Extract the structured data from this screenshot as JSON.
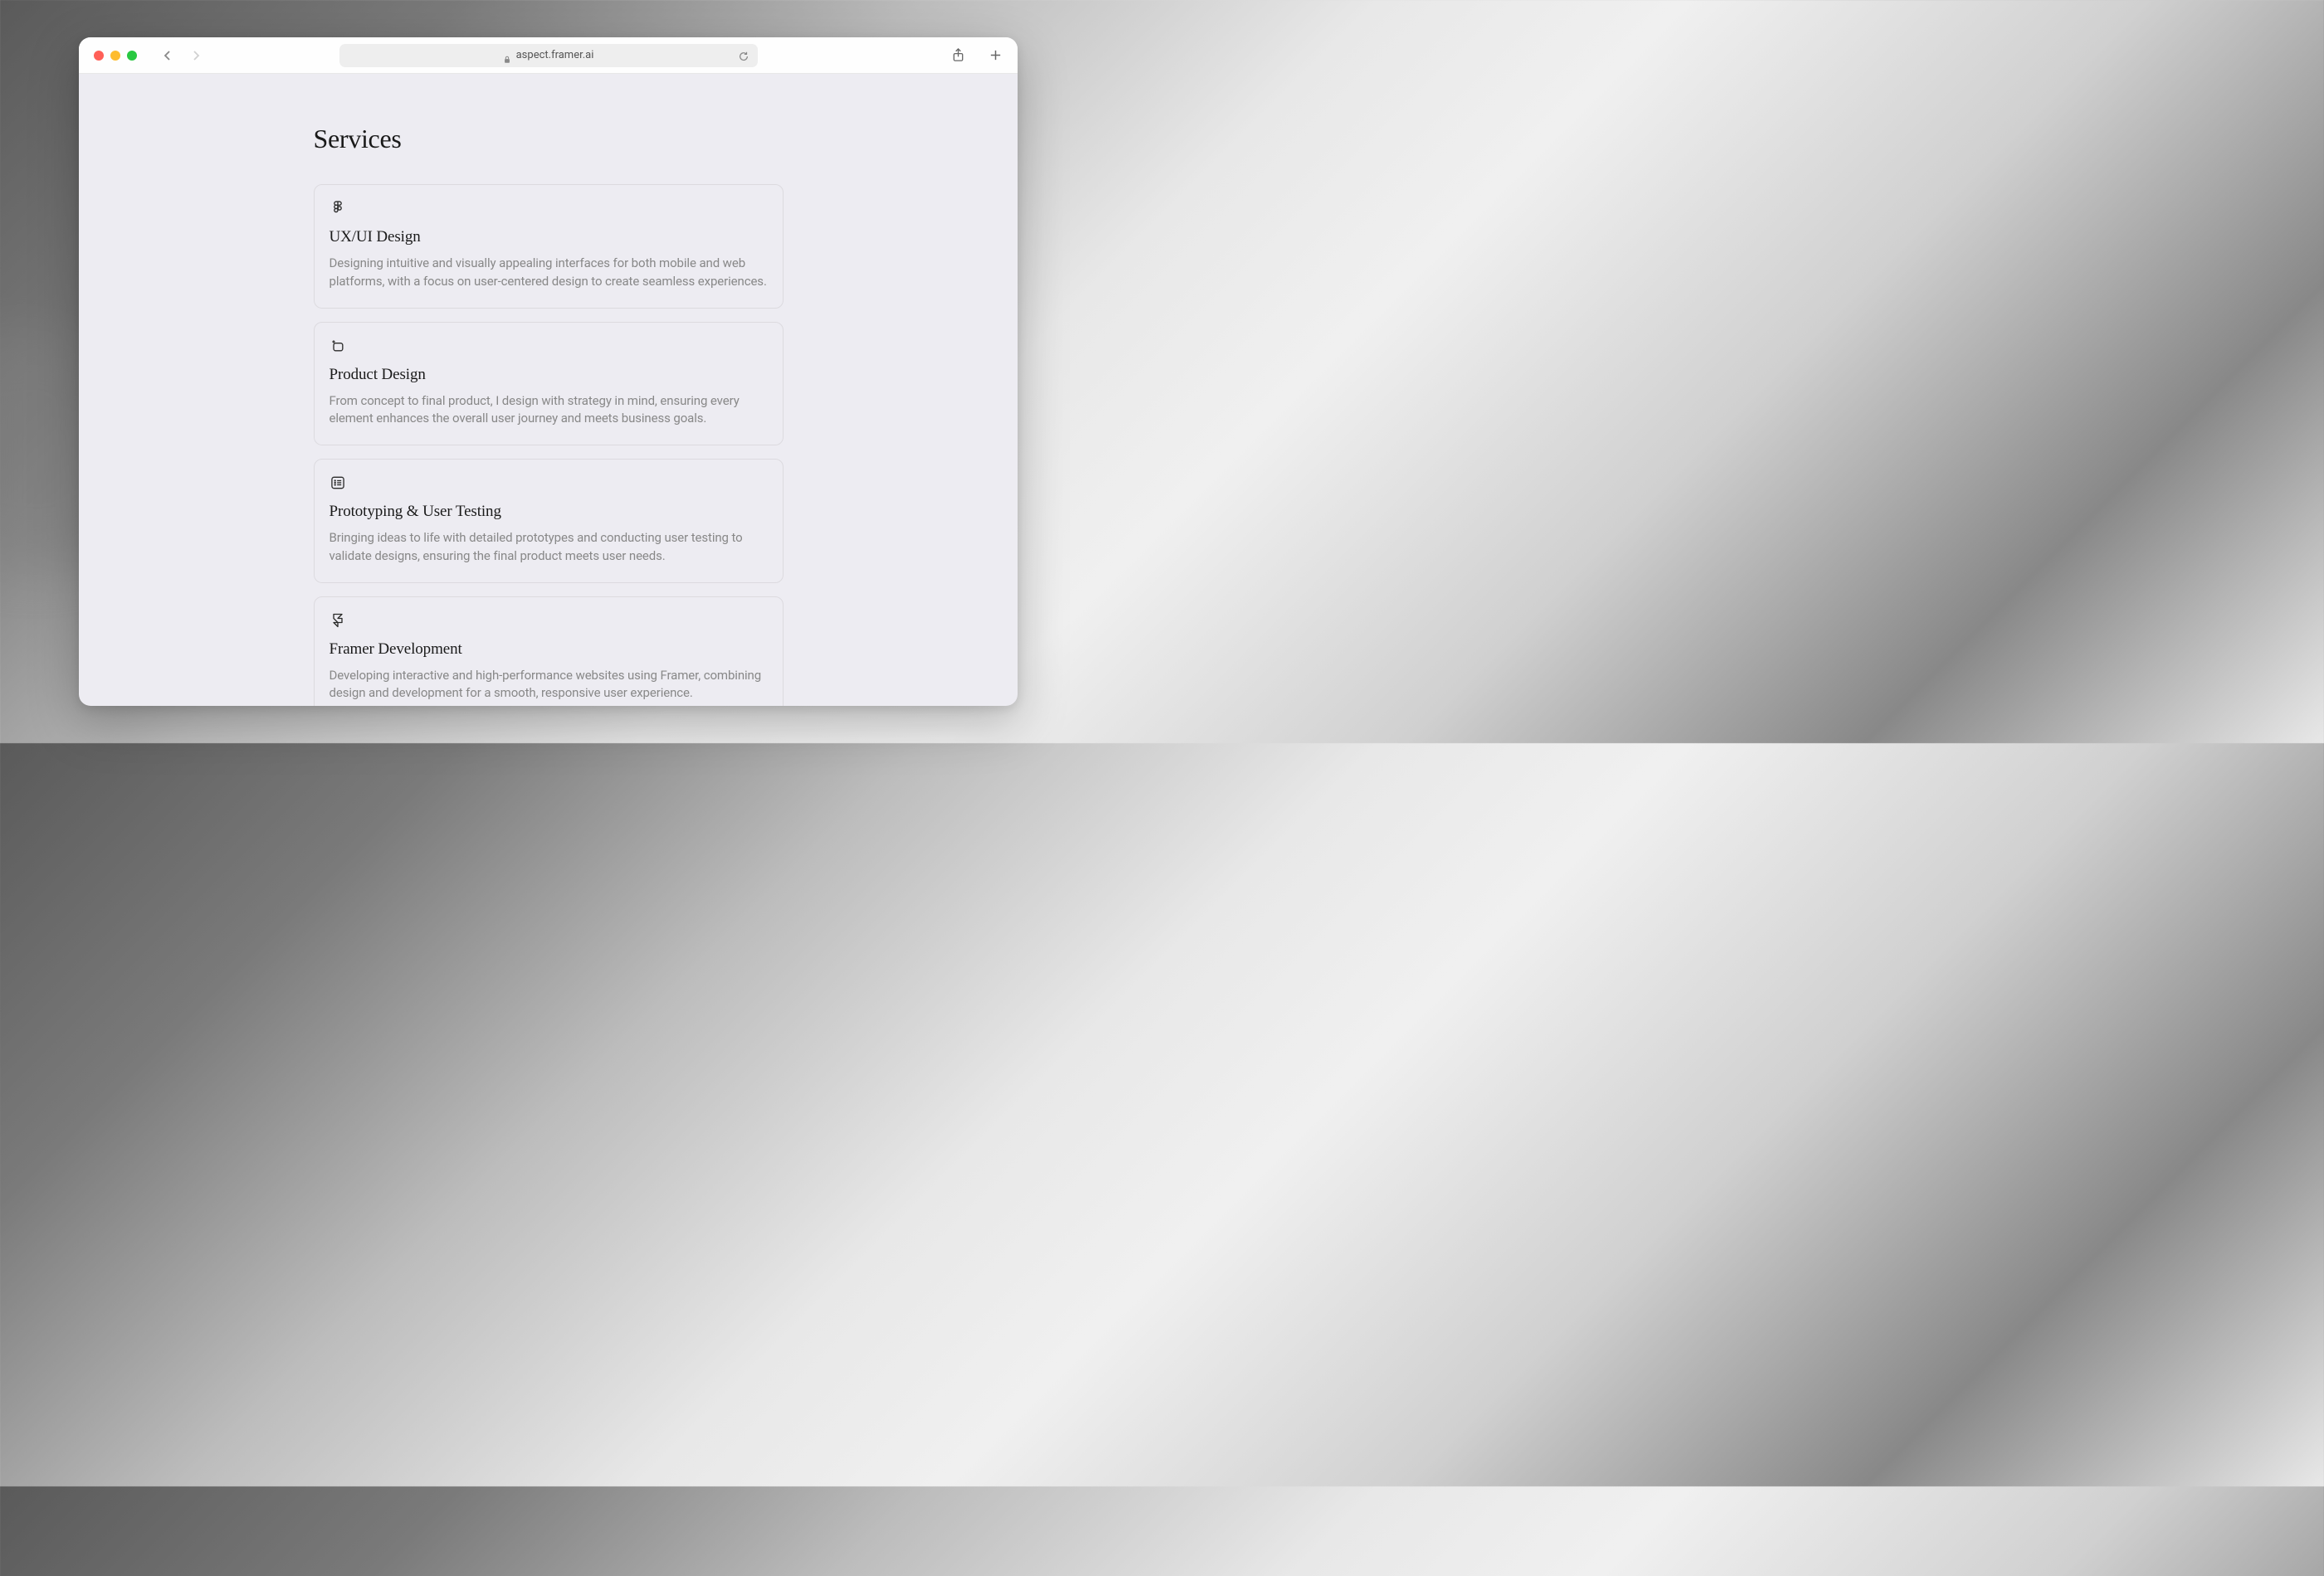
{
  "browser": {
    "url": "aspect.framer.ai"
  },
  "page": {
    "title": "Services"
  },
  "services": [
    {
      "title": "UX/UI Design",
      "description": "Designing intuitive and visually appealing interfaces for both mobile and web platforms, with a focus on user-centered design to create seamless experiences."
    },
    {
      "title": "Product Design",
      "description": "From concept to final product, I design with strategy in mind, ensuring every element enhances the overall user journey and meets business goals."
    },
    {
      "title": "Prototyping & User Testing",
      "description": "Bringing ideas to life with detailed prototypes and conducting user testing to validate designs, ensuring the final product meets user needs."
    },
    {
      "title": "Framer Development",
      "description": "Developing interactive and high-performance websites using Framer, combining design and development for a smooth, responsive user experience."
    }
  ]
}
